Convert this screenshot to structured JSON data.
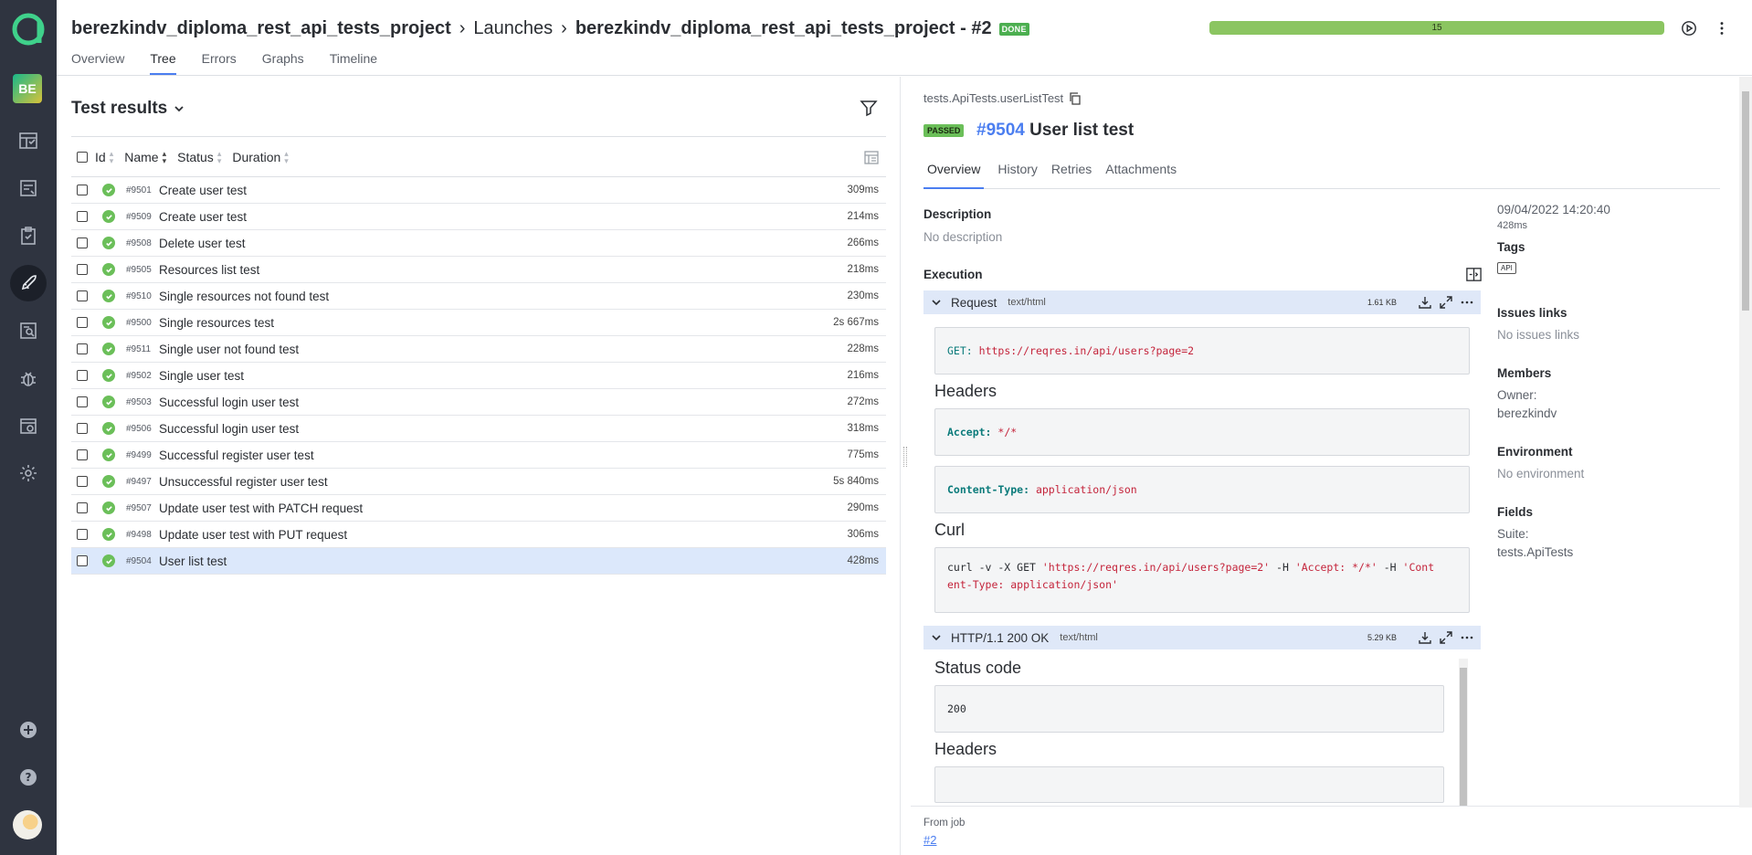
{
  "header": {
    "project": "berezkindv_diploma_rest_api_tests_project",
    "launches": "Launches",
    "launch": "berezkindv_diploma_rest_api_tests_project - #2",
    "status_badge": "DONE",
    "progress_count": "15",
    "tabs": [
      "Overview",
      "Tree",
      "Errors",
      "Graphs",
      "Timeline"
    ],
    "active_tab": "Tree"
  },
  "rail": {
    "project_initials": "BE"
  },
  "left": {
    "title": "Test results",
    "columns": [
      "Id",
      "Name",
      "Status",
      "Duration"
    ],
    "rows": [
      {
        "id": "#9501",
        "name": "Create user test",
        "duration": "309ms"
      },
      {
        "id": "#9509",
        "name": "Create user test",
        "duration": "214ms"
      },
      {
        "id": "#9508",
        "name": "Delete user test",
        "duration": "266ms"
      },
      {
        "id": "#9505",
        "name": "Resources list test",
        "duration": "218ms"
      },
      {
        "id": "#9510",
        "name": "Single resources not found test",
        "duration": "230ms"
      },
      {
        "id": "#9500",
        "name": "Single resources test",
        "duration": "2s 667ms"
      },
      {
        "id": "#9511",
        "name": "Single user not found test",
        "duration": "228ms"
      },
      {
        "id": "#9502",
        "name": "Single user test",
        "duration": "216ms"
      },
      {
        "id": "#9503",
        "name": "Successful login user test",
        "duration": "272ms"
      },
      {
        "id": "#9506",
        "name": "Successful login user test",
        "duration": "318ms"
      },
      {
        "id": "#9499",
        "name": "Successful register user test",
        "duration": "775ms"
      },
      {
        "id": "#9497",
        "name": "Unsuccessful register user test",
        "duration": "5s 840ms"
      },
      {
        "id": "#9507",
        "name": "Update user test with PATCH request",
        "duration": "290ms"
      },
      {
        "id": "#9498",
        "name": "Update user test with PUT request",
        "duration": "306ms"
      },
      {
        "id": "#9504",
        "name": "User list test",
        "duration": "428ms"
      }
    ]
  },
  "right": {
    "fqn": "tests.ApiTests.userListTest",
    "status": "PASSED",
    "test_id": "#9504",
    "test_name": "User list test",
    "tabs": [
      "Overview",
      "History",
      "Retries",
      "Attachments"
    ],
    "description_label": "Description",
    "description_value": "No description",
    "execution_label": "Execution",
    "request": {
      "title": "Request",
      "mime": "text/html",
      "size": "1.61 KB",
      "method": "GET:",
      "url": "https://reqres.in/api/users?page=2",
      "headers_title": "Headers",
      "h1_key": "Accept:",
      "h1_val": "*/*",
      "h2_key": "Content-Type:",
      "h2_val": "application/json",
      "curl_title": "Curl",
      "curl_cmd": "curl -v -X GET ",
      "curl_url": "'https://reqres.in/api/users?page=2'",
      "curl_h": " -H ",
      "curl_accept": "'Accept: */*'",
      "curl_h2": " -H ",
      "curl_ct1": "'Cont",
      "curl_ct2": "ent-Type: application/json'"
    },
    "response": {
      "title": "HTTP/1.1 200 OK",
      "mime": "text/html",
      "size": "5.29 KB",
      "status_title": "Status code",
      "status_value": "200",
      "headers_title": "Headers"
    },
    "meta": {
      "datetime": "09/04/2022 14:20:40",
      "duration": "428ms",
      "tags_label": "Tags",
      "tag": "API",
      "issues_label": "Issues links",
      "issues_value": "No issues links",
      "members_label": "Members",
      "owner_label": "Owner:",
      "owner_value": "berezkindv",
      "env_label": "Environment",
      "env_value": "No environment",
      "fields_label": "Fields",
      "suite_label": "Suite:",
      "suite_value": "tests.ApiTests"
    },
    "footer": {
      "from_job": "From job",
      "job_link": "#2"
    }
  }
}
